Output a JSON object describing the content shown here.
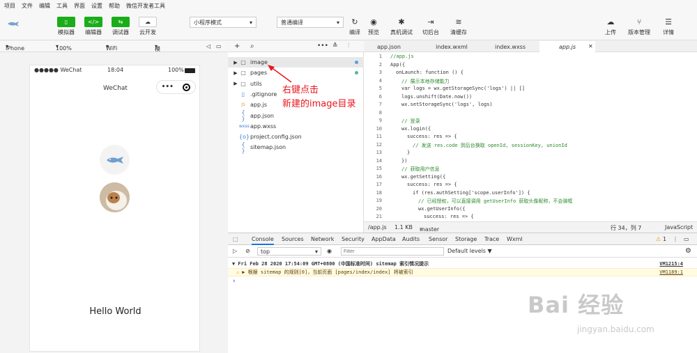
{
  "menu": [
    "项目",
    "文件",
    "编辑",
    "工具",
    "界面",
    "设置",
    "帮助",
    "微信开发者工具"
  ],
  "toolbar": {
    "simulator": "模拟器",
    "editor": "编辑器",
    "debugger": "调试器",
    "cloud": "云开发",
    "mode_select": "小程序模式",
    "compile_select": "普通编译",
    "compile": "编译",
    "preview": "预览",
    "device_debug": "真机调试",
    "background": "切后台",
    "cache": "清缓存",
    "upload": "上传",
    "version": "版本管理",
    "detail": "详情"
  },
  "devbar": {
    "device": "iPhone 6/...",
    "zoom": "100%",
    "network": "WiFi",
    "operation": "模拟操作"
  },
  "phone": {
    "carrier": "●●●●● WeChat",
    "time": "18:04",
    "battery": "100%",
    "nav_title": "WeChat",
    "capsule_more": "•••",
    "hello": "Hello World"
  },
  "files": [
    {
      "name": "image",
      "type": "folder",
      "arrow": "▶",
      "icon": "▢"
    },
    {
      "name": "pages",
      "type": "folder",
      "arrow": "▶",
      "icon": "▢"
    },
    {
      "name": "utils",
      "type": "folder",
      "arrow": "▶",
      "icon": "▢"
    },
    {
      "name": ".gitignore",
      "type": "file",
      "arrow": "",
      "icon": "▯"
    },
    {
      "name": "app.js",
      "type": "file",
      "arrow": "",
      "icon": "JS"
    },
    {
      "name": "app.json",
      "type": "file",
      "arrow": "",
      "icon": "{ }"
    },
    {
      "name": "app.wxss",
      "type": "file",
      "arrow": "",
      "icon": "wxss"
    },
    {
      "name": "project.config.json",
      "type": "file",
      "arrow": "",
      "icon": "{o}"
    },
    {
      "name": "sitemap.json",
      "type": "file",
      "arrow": "",
      "icon": "{ }"
    }
  ],
  "annotation": {
    "line1": "右键点击",
    "line2": "新建的image目录"
  },
  "tabs": [
    "app.json",
    "index.wxml",
    "index.wxss",
    "app.js"
  ],
  "code_lines": [
    {
      "n": "1",
      "t": "//app.js",
      "c": "c-c",
      "i": 0
    },
    {
      "n": "2",
      "t": "App({",
      "c": "",
      "i": 0
    },
    {
      "n": "3",
      "t": "onLaunch: function () {",
      "c": "",
      "i": 1
    },
    {
      "n": "4",
      "t": "// 展示本地存储能力",
      "c": "c-c",
      "i": 2
    },
    {
      "n": "5",
      "t": "var logs = wx.getStorageSync('logs') || []",
      "c": "",
      "i": 2
    },
    {
      "n": "6",
      "t": "logs.unshift(Date.now())",
      "c": "",
      "i": 2
    },
    {
      "n": "7",
      "t": "wx.setStorageSync('logs', logs)",
      "c": "",
      "i": 2
    },
    {
      "n": "8",
      "t": "",
      "c": "",
      "i": 0
    },
    {
      "n": "9",
      "t": "// 登录",
      "c": "c-c",
      "i": 2
    },
    {
      "n": "10",
      "t": "wx.login({",
      "c": "",
      "i": 2
    },
    {
      "n": "11",
      "t": "success: res => {",
      "c": "",
      "i": 3
    },
    {
      "n": "12",
      "t": "// 发送 res.code 到后台换取 openId, sessionKey, unionId",
      "c": "c-c",
      "i": 4
    },
    {
      "n": "13",
      "t": "}",
      "c": "",
      "i": 3
    },
    {
      "n": "14",
      "t": "})",
      "c": "",
      "i": 2
    },
    {
      "n": "15",
      "t": "// 获取用户信息",
      "c": "c-c",
      "i": 2
    },
    {
      "n": "16",
      "t": "wx.getSetting({",
      "c": "",
      "i": 2
    },
    {
      "n": "17",
      "t": "success: res => {",
      "c": "",
      "i": 3
    },
    {
      "n": "18",
      "t": "if (res.authSetting['scope.userInfo']) {",
      "c": "",
      "i": 4
    },
    {
      "n": "19",
      "t": "// 已经授权，可以直接调用 getUserInfo 获取头像昵称，不会弹框",
      "c": "c-c",
      "i": 5
    },
    {
      "n": "20",
      "t": "wx.getUserInfo({",
      "c": "",
      "i": 5
    },
    {
      "n": "21",
      "t": "success: res => {",
      "c": "",
      "i": 6
    }
  ],
  "statusbar": {
    "path": "/app.js",
    "size": "1.1 KB",
    "branch": "master",
    "pos": "行 34，列 7",
    "lang": "JavaScript"
  },
  "console_tabs": [
    "Console",
    "Sources",
    "Network",
    "Security",
    "AppData",
    "Audits",
    "Sensor",
    "Storage",
    "Trace",
    "Wxml"
  ],
  "console": {
    "context": "top",
    "filter_placeholder": "Filter",
    "levels": "Default levels ▼",
    "warn_count": "1",
    "line1": "▼ Fri Feb 28 2020 17:54:09 GMT+0800 (中国标准时间) sitemap 索引情况提示",
    "line1_src": "VM1215:4",
    "line2": "▶ 根据 sitemap 的规则[0]，当前页面 [pages/index/index] 将被索引",
    "line2_src": "VM1189:1",
    "prompt": "›"
  },
  "watermark": {
    "main": "Bai 经验",
    "sub": "jingyan.baidu.com"
  }
}
